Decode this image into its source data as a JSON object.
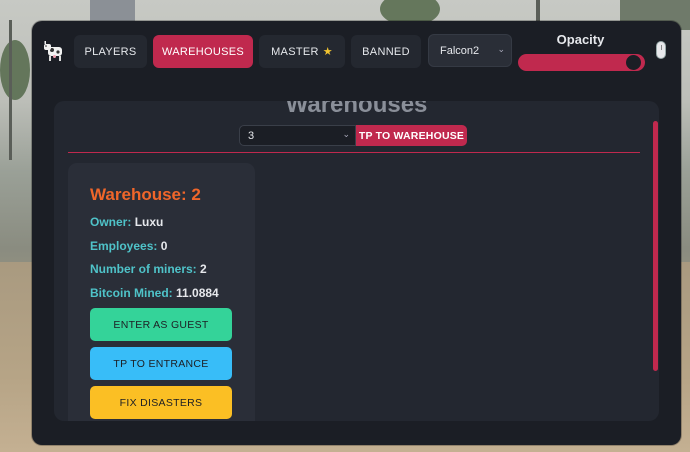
{
  "tabs": [
    {
      "label": "PLAYERS",
      "active": false
    },
    {
      "label": "WAREHOUSES",
      "active": true
    },
    {
      "label": "MASTER",
      "active": false,
      "icon": "star-icon"
    },
    {
      "label": "BANNED",
      "active": false
    }
  ],
  "player_select": {
    "value": "Falcon2"
  },
  "opacity": {
    "label": "Opacity",
    "value": 100
  },
  "panel": {
    "title": "Warehouses",
    "warehouse_input": "3",
    "tp_button": "TP TO WAREHOUSE"
  },
  "card": {
    "title": "Warehouse: 2",
    "fields": [
      {
        "label": "Owner:",
        "value": "Luxu"
      },
      {
        "label": "Employees:",
        "value": "0"
      },
      {
        "label": "Number of miners:",
        "value": "2"
      },
      {
        "label": "Bitcoin Mined:",
        "value": "11.0884"
      }
    ],
    "buttons": [
      {
        "label": "ENTER AS GUEST",
        "color": "#34d399"
      },
      {
        "label": "TP TO ENTRANCE",
        "color": "#38bdf8"
      },
      {
        "label": "FIX DISASTERS",
        "color": "#fbbf24"
      }
    ]
  },
  "colors": {
    "accent": "#c0294e",
    "card_title": "#f0662a",
    "field_label": "#4fc3c9"
  }
}
